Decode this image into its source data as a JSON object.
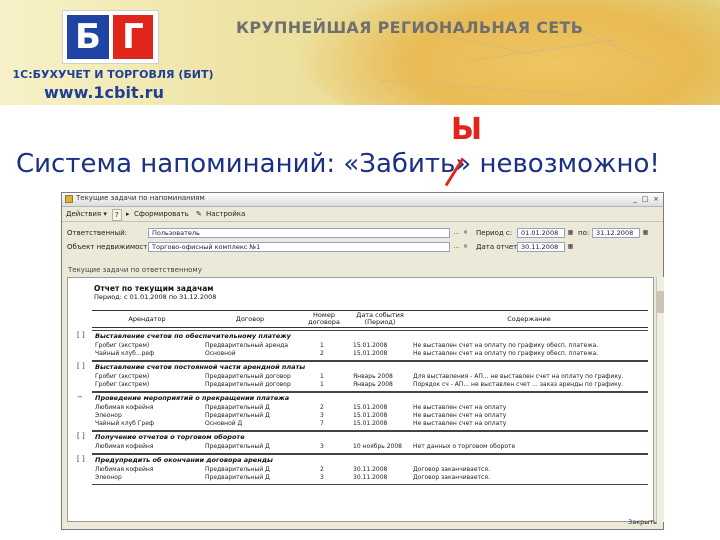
{
  "banner": {
    "logo_left": "Б",
    "logo_right": "Г",
    "company": "1С:БУХУЧЕТ И ТОРГОВЛЯ (БИТ)",
    "site": "www.1cbit.ru",
    "network": "КРУПНЕЙШАЯ РЕГИОНАЛЬНАЯ СЕТЬ"
  },
  "headline": {
    "text": "Система напоминаний: «Забить» невозможно!",
    "correction": "Ы"
  },
  "window": {
    "title": "Текущие задачи по напоминаниям",
    "toolbar": {
      "actions": "Действия ▾",
      "help": "?",
      "generate": "Сформировать",
      "settings": "Настройка"
    },
    "fields": {
      "responsible_label": "Ответственный:",
      "responsible_value": "Пользователь",
      "object_label": "Объект недвижимости:",
      "object_value": "Торгово-офисный комплекс №1",
      "period_label": "Период с:",
      "period_from": "01.01.2008",
      "period_to_label": "по:",
      "period_to": "31.12.2008",
      "control_date_label": "Дата отчета:",
      "control_date": "30.11.2008"
    },
    "section_title": "Текущие задачи по ответственному",
    "report": {
      "title": "Отчет по текущим задачам",
      "period": "Период: с 01.01.2008 по 31.12.2008",
      "columns": [
        "Арендатор",
        "Договор",
        "Номер договора",
        "Дата события (Период)",
        "Содержание"
      ],
      "groups": [
        {
          "title": "Выставление счетов по обеспечительному платежу",
          "rows": [
            [
              "Гробиг (экстрем)",
              "Предварительный аренда",
              "1",
              "15.01.2008",
              "Не выставлен счет на оплату по графику обесп. платежа."
            ],
            [
              "Чайный клуб...реф",
              "Основной",
              "2",
              "15.01.2008",
              "Не выставлен счет на оплату по графику обесп. платежа."
            ]
          ]
        },
        {
          "title": "Выставление счетов постоянной части арендной платы",
          "rows": [
            [
              "Гробиг (экстрем)",
              "Предварительный договор",
              "1",
              "Январь 2008",
              "Для выставления - АП... не выставлен счет на оплату по графику."
            ],
            [
              "Гробиг (экстрем)",
              "Предварительный договор",
              "1",
              "Январь 2008",
              "Порядок сч - АП... не выставлен счет ... заказ аренды по графику."
            ]
          ]
        },
        {
          "title": "Проведение мероприятий о прекращении платежа",
          "rows": [
            [
              "Любимая кофейня",
              "Предварительный Д",
              "2",
              "15.01.2008",
              "Не выставлен счет на оплату"
            ],
            [
              "Элеонор",
              "Предварительный Д",
              "3",
              "15.01.2008",
              "Не выставлен счет на оплату"
            ],
            [
              "Чайный клуб Греф",
              "Основной Д",
              "7",
              "15.01.2008",
              "Не выставлен счет на оплату"
            ]
          ]
        },
        {
          "title": "Получение отчетов о торговом обороте",
          "rows": [
            [
              "Любимая кофейня",
              "Предварительный Д",
              "3",
              "10 ноябрь 2008",
              "Нет данных о торговом обороте"
            ]
          ]
        },
        {
          "title": "Предупредить об окончании договора аренды",
          "rows": [
            [
              "Любимая кофейня",
              "Предварительный Д",
              "2",
              "30.11.2008",
              "Договор заканчивается."
            ],
            [
              "Элеонор",
              "Предварительный Д",
              "3",
              "30.11.2008",
              "Договор заканчивается."
            ]
          ]
        }
      ]
    },
    "close_button": "Закрыть"
  }
}
